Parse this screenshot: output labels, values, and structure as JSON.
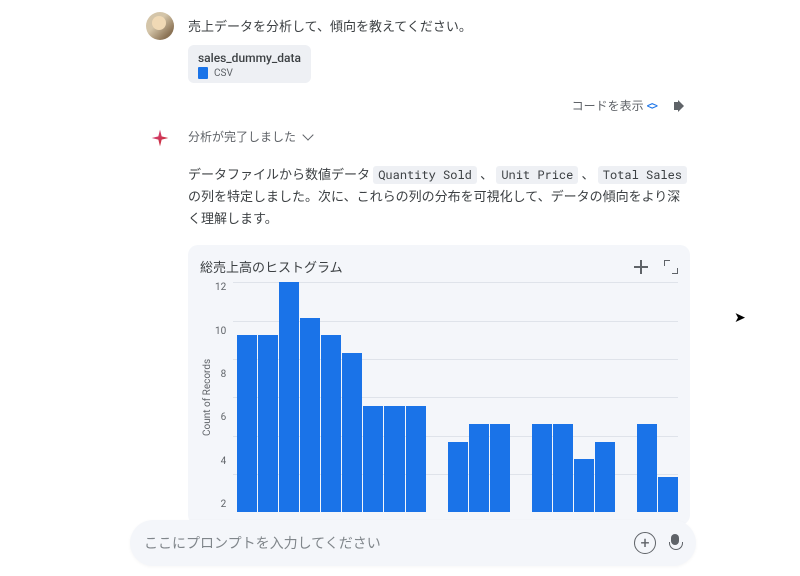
{
  "user": {
    "message": "売上データを分析して、傾向を教えてください。",
    "attachment": {
      "name": "sales_dummy_data",
      "type": "CSV"
    }
  },
  "controls": {
    "show_code": "コードを表示"
  },
  "assistant": {
    "status": "分析が完了しました",
    "reply_pre": "データファイルから数値データ ",
    "col1": "Quantity Sold",
    "col2": "Unit Price",
    "col3": "Total Sales",
    "reply_mid": " 、 ",
    "reply_post": " の列を特定しました。次に、これらの列の分布を可視化して、データの傾向をより深く理解します。"
  },
  "chart_data": {
    "type": "bar",
    "title": "総売上高のヒストグラム",
    "ylabel": "Count of Records",
    "yticks": [
      "12",
      "10",
      "8",
      "6",
      "4",
      "2"
    ],
    "ylim": [
      0,
      13
    ],
    "bins": 21,
    "values": [
      10,
      10,
      13,
      11,
      10,
      9,
      6,
      6,
      6,
      0,
      4,
      5,
      5,
      0,
      5,
      5,
      3,
      4,
      0,
      5,
      2
    ]
  },
  "prompt": {
    "placeholder": "ここにプロンプトを入力してください"
  }
}
